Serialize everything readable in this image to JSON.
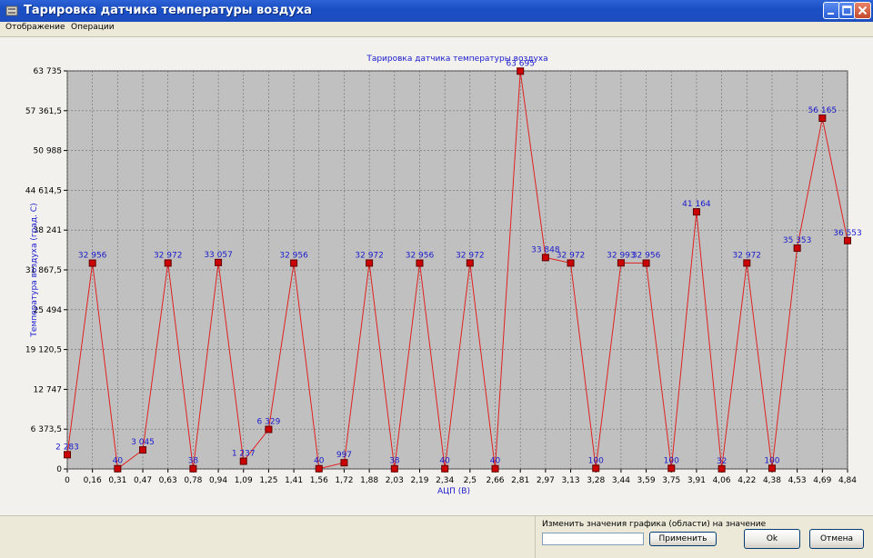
{
  "window": {
    "title": "Тарировка датчика температуры воздуха",
    "minimize_icon": "minimize-icon",
    "maximize_icon": "maximize-icon",
    "close_icon": "close-icon"
  },
  "menu": [
    "Отображение",
    "Операции"
  ],
  "chart_data": {
    "type": "line",
    "title": "Тарировка датчика температуры воздуха",
    "xlabel": "АЦП (В)",
    "ylabel": "Температура воздуха (град. С)",
    "x_tick_labels": [
      "0",
      "0,16",
      "0,31",
      "0,47",
      "0,63",
      "0,78",
      "0,94",
      "1,09",
      "1,25",
      "1,41",
      "1,56",
      "1,72",
      "1,88",
      "2,03",
      "2,19",
      "2,34",
      "2,5",
      "2,66",
      "2,81",
      "2,97",
      "3,13",
      "3,28",
      "3,44",
      "3,59",
      "3,75",
      "3,91",
      "4,06",
      "4,22",
      "4,38",
      "4,53",
      "4,69",
      "4,84"
    ],
    "y_tick_labels": [
      "0",
      "6 373,5",
      "12 747",
      "19 120,5",
      "25 494",
      "31 867,5",
      "38 241",
      "44 614,5",
      "50 988",
      "57 361,5",
      "63 735"
    ],
    "ylim": [
      0,
      63735
    ],
    "grid": true,
    "line_color": "#e02020",
    "point_color": "#cc0000",
    "label_color": "#1a1acc",
    "plot_background": "#c0c0c0",
    "series": [
      {
        "values": [
          2283,
          32956,
          40,
          3045,
          32972,
          38,
          33057,
          1237,
          6329,
          32956,
          40,
          997,
          32972,
          38,
          32956,
          40,
          32972,
          40,
          63695,
          33848,
          32972,
          100,
          32993,
          32956,
          100,
          41164,
          32,
          32972,
          100,
          35353,
          56165,
          36553
        ],
        "labels": [
          "2 283",
          "32 956",
          "40",
          "3 045",
          "32 972",
          "38",
          "33 057",
          "1 237",
          "6 329",
          "32 956",
          "40",
          "997",
          "32 972",
          "38",
          "32 956",
          "40",
          "32 972",
          "40",
          "63 695",
          "33 848",
          "32 972",
          "100",
          "32 993",
          "32 956",
          "100",
          "41 164",
          "32",
          "32 972",
          "100",
          "35 353",
          "56 165",
          "36 553"
        ]
      }
    ]
  },
  "footer": {
    "change_label": "Изменить значения графика (области) на значение",
    "value_input": "",
    "apply_label": "Применить",
    "ok_label": "Ok",
    "cancel_label": "Отмена"
  }
}
